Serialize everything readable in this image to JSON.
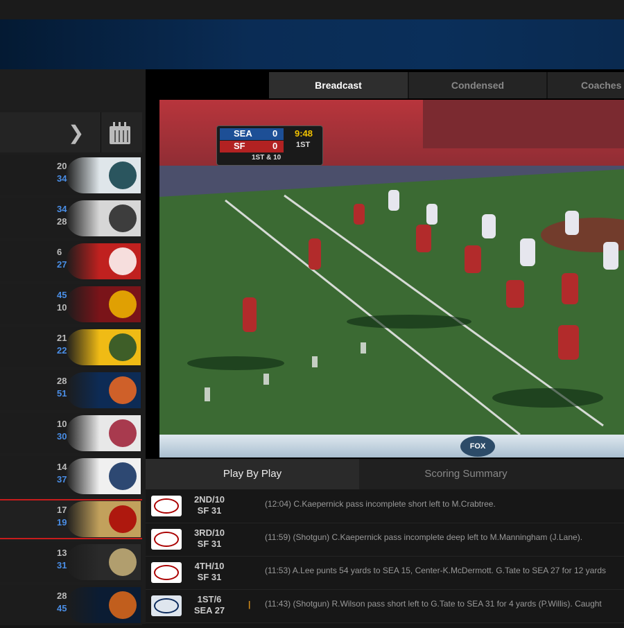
{
  "video_tabs": [
    "Breadcast",
    "Condensed",
    "Coaches"
  ],
  "scorebug": {
    "away": "SEA",
    "away_score": "0",
    "home": "SF",
    "home_score": "0",
    "clock": "9:48",
    "quarter": "1ST",
    "down": "1ST & 10"
  },
  "broadcast_logo": "FOX",
  "bottom_tabs": [
    "Play By Play",
    "Scoring Summary"
  ],
  "games": [
    {
      "score1": "20",
      "score2": "34",
      "score1_color": "#bbbbbb",
      "score2_color": "#4a8ee6",
      "logo_bg": "#dfe6ea",
      "logo_fg": "#0b3b45",
      "icon": "eagles-logo-icon"
    },
    {
      "score1": "34",
      "score2": "28",
      "score1_color": "#4a8ee6",
      "score2_color": "#bbbbbb",
      "logo_bg": "#d7d7d7",
      "logo_fg": "#222222",
      "icon": "steelers-logo-icon"
    },
    {
      "score1": "6",
      "score2": "27",
      "score1_color": "#bbbbbb",
      "score2_color": "#4a8ee6",
      "logo_bg": "#c0211f",
      "logo_fg": "#ffffff",
      "icon": "buccaneers-logo-icon"
    },
    {
      "score1": "45",
      "score2": "10",
      "score1_color": "#4a8ee6",
      "score2_color": "#bbbbbb",
      "logo_bg": "#7a1419",
      "logo_fg": "#f2b800",
      "icon": "redskins-logo-icon"
    },
    {
      "score1": "21",
      "score2": "22",
      "score1_color": "#bbbbbb",
      "score2_color": "#4a8ee6",
      "logo_bg": "#f0bb15",
      "logo_fg": "#1f4d2b",
      "icon": "packers-logo-icon"
    },
    {
      "score1": "28",
      "score2": "51",
      "score1_color": "#bbbbbb",
      "score2_color": "#4a8ee6",
      "logo_bg": "#0d2b55",
      "logo_fg": "#f26a22",
      "icon": "broncos-logo-icon"
    },
    {
      "score1": "10",
      "score2": "30",
      "score1_color": "#bbbbbb",
      "score2_color": "#4a8ee6",
      "logo_bg": "#e8e8e8",
      "logo_fg": "#9c1b32",
      "icon": "cardinals-logo-icon"
    },
    {
      "score1": "14",
      "score2": "37",
      "score1_color": "#bbbbbb",
      "score2_color": "#4a8ee6",
      "logo_bg": "#f0f0f0",
      "logo_fg": "#0a2a5c",
      "icon": "chargers-logo-icon"
    },
    {
      "score1": "17",
      "score2": "19",
      "score1_color": "#bbbbbb",
      "score2_color": "#4a8ee6",
      "logo_bg": "#c2a15c",
      "logo_fg": "#aa0000",
      "icon": "49ers-logo-icon",
      "active": true
    },
    {
      "score1": "13",
      "score2": "31",
      "score1_color": "#bbbbbb",
      "score2_color": "#4a8ee6",
      "logo_bg": "#2a2a2a",
      "logo_fg": "#c9b37a",
      "icon": "saints-logo-icon"
    },
    {
      "score1": "28",
      "score2": "45",
      "score1_color": "#bbbbbb",
      "score2_color": "#4a8ee6",
      "logo_bg": "#0b1c33",
      "logo_fg": "#e26a1a",
      "icon": "bears-logo-icon"
    }
  ],
  "plays": [
    {
      "down": "2ND/10",
      "spot": "SF 31",
      "team": "SF",
      "icon": "49ers-logo-icon",
      "icon_bg": "#ffffff",
      "icon_fg": "#aa0000",
      "desc": "(12:04) C.Kaepernick pass incomplete short left to M.Crabtree."
    },
    {
      "down": "3RD/10",
      "spot": "SF 31",
      "team": "SF",
      "icon": "49ers-logo-icon",
      "icon_bg": "#ffffff",
      "icon_fg": "#aa0000",
      "desc": "(11:59) (Shotgun) C.Kaepernick pass incomplete deep left to M.Manningham (J.Lane)."
    },
    {
      "down": "4TH/10",
      "spot": "SF 31",
      "team": "SF",
      "icon": "49ers-logo-icon",
      "icon_bg": "#ffffff",
      "icon_fg": "#aa0000",
      "desc": "(11:53) A.Lee punts 54 yards to SEA 15, Center-K.McDermott. G.Tate to SEA 27 for 12 yards"
    },
    {
      "down": "1ST/6",
      "spot": "SEA 27",
      "team": "SEA",
      "icon": "seahawks-logo-icon",
      "icon_bg": "#dfe6ee",
      "icon_fg": "#0b2a5c",
      "desc": "(11:43) (Shotgun) R.Wilson pass short left to G.Tate to SEA 31 for 4 yards (P.Willis). Caught",
      "marker": "|"
    }
  ]
}
